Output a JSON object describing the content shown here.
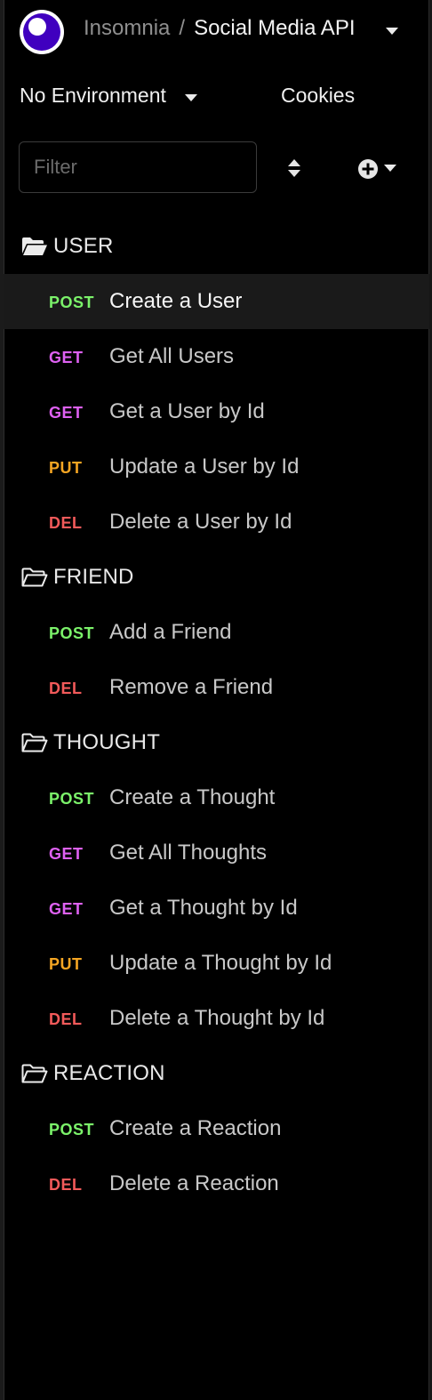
{
  "header": {
    "app_name": "Insomnia",
    "separator": "/",
    "project": "Social Media API"
  },
  "environment": {
    "selected": "No Environment",
    "cookies_label": "Cookies"
  },
  "filter": {
    "placeholder": "Filter",
    "value": ""
  },
  "colors": {
    "post": "#7bf26a",
    "get": "#de61f2",
    "put": "#f5a623",
    "del": "#f25a5a",
    "logo": "#4000bf"
  },
  "folders": [
    {
      "name": "USER",
      "icon": "folder-open-icon",
      "requests": [
        {
          "method": "POST",
          "label": "Create a User",
          "active": true
        },
        {
          "method": "GET",
          "label": "Get All Users"
        },
        {
          "method": "GET",
          "label": "Get a User by Id"
        },
        {
          "method": "PUT",
          "label": "Update a User by Id"
        },
        {
          "method": "DEL",
          "label": "Delete a User by Id"
        }
      ]
    },
    {
      "name": "FRIEND",
      "icon": "folder-icon",
      "requests": [
        {
          "method": "POST",
          "label": "Add a Friend"
        },
        {
          "method": "DEL",
          "label": "Remove a Friend"
        }
      ]
    },
    {
      "name": "THOUGHT",
      "icon": "folder-icon",
      "requests": [
        {
          "method": "POST",
          "label": "Create a Thought"
        },
        {
          "method": "GET",
          "label": "Get All Thoughts"
        },
        {
          "method": "GET",
          "label": "Get a Thought by Id"
        },
        {
          "method": "PUT",
          "label": "Update a Thought by Id"
        },
        {
          "method": "DEL",
          "label": "Delete a Thought by Id"
        }
      ]
    },
    {
      "name": "REACTION",
      "icon": "folder-icon",
      "requests": [
        {
          "method": "POST",
          "label": "Create a Reaction"
        },
        {
          "method": "DEL",
          "label": "Delete a Reaction"
        }
      ]
    }
  ]
}
